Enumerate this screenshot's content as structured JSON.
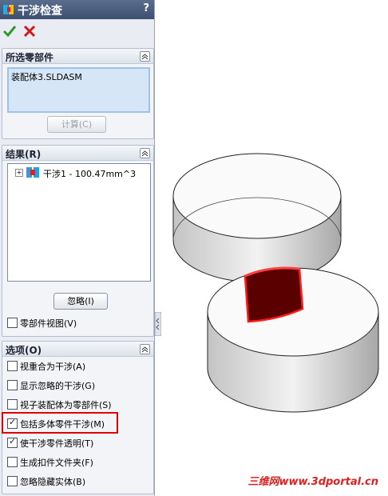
{
  "panel": {
    "title": "干涉检查",
    "help": "?"
  },
  "selected": {
    "header": "所选零部件",
    "item": "装配体3.SLDASM",
    "compute_button": "计算(C)"
  },
  "results": {
    "header": "结果(R)",
    "tree_item": "干涉1 - 100.47mm^3",
    "expander": "+",
    "ignore_button": "忽略(I)",
    "component_view": {
      "label": "零部件视图(V)",
      "checked": false
    }
  },
  "options": {
    "header": "选项(O)",
    "items": [
      {
        "label": "视重合为干涉(A)",
        "checked": false
      },
      {
        "label": "显示忽略的干涉(G)",
        "checked": false
      },
      {
        "label": "视子装配体为零部件(S)",
        "checked": false
      },
      {
        "label": "包括多体零件干涉(M)",
        "checked": true
      },
      {
        "label": "使干涉零件透明(T)",
        "checked": true
      },
      {
        "label": "生成扣件文件夹(F)",
        "checked": false
      },
      {
        "label": "忽略隐藏实体(B)",
        "checked": false
      }
    ]
  },
  "watermark": "三维网www.3dportal.cn",
  "colors": {
    "accent_red": "#e00000",
    "interference": "#5a0000"
  }
}
